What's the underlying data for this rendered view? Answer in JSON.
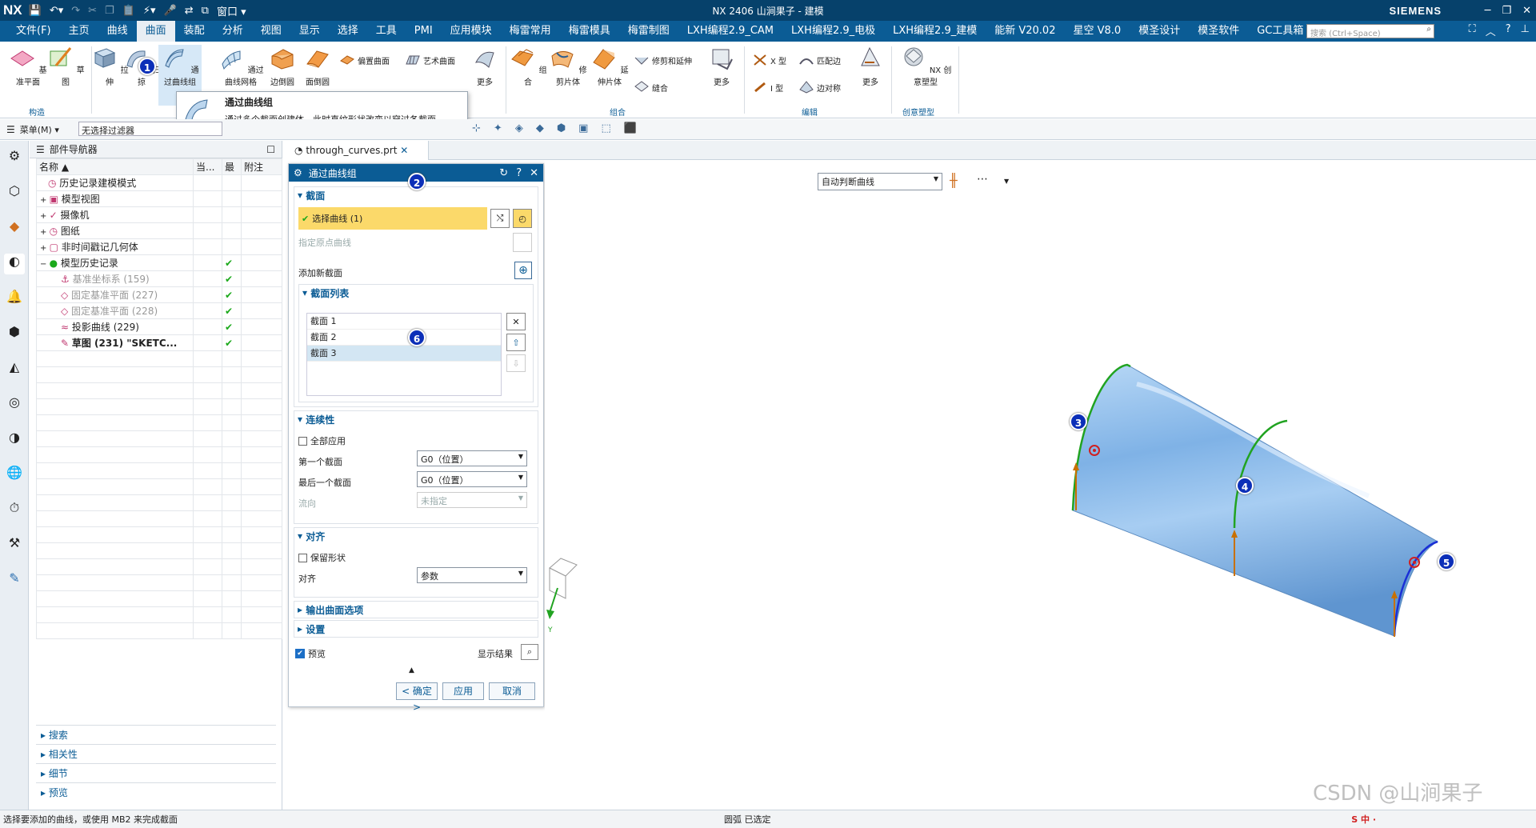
{
  "titlebar": {
    "app": "NX",
    "title": "NX 2406 山涧果子 - 建模",
    "brand": "SIEMENS",
    "window_menu": "窗口"
  },
  "menubar": {
    "file": "文件(F)",
    "items": [
      "主页",
      "曲线",
      "曲面",
      "装配",
      "分析",
      "视图",
      "显示",
      "选择",
      "工具",
      "PMI",
      "应用模块",
      "梅雷常用",
      "梅雷模具",
      "梅雷制图",
      "LXH编程2.9_CAM",
      "LXH编程2.9_电极",
      "LXH编程2.9_建模",
      "能新 V20.02",
      "星空 V8.0",
      "模圣设计",
      "模圣软件",
      "GC工具箱"
    ],
    "active_index": 2,
    "search_placeholder": "搜索 (Ctrl+Space)"
  },
  "ribbon": {
    "buttons": [
      {
        "label": "基准平面"
      },
      {
        "label": "草图"
      },
      {
        "label": "拉伸"
      },
      {
        "label": "扫掠"
      },
      {
        "label": "通过曲线组"
      },
      {
        "label": "通过曲线网格"
      },
      {
        "label": "边倒圆"
      },
      {
        "label": "面倒圆"
      },
      {
        "label": "更多"
      },
      {
        "label": "组合"
      },
      {
        "label": "修剪片体"
      },
      {
        "label": "延伸片体"
      },
      {
        "label": "更多"
      },
      {
        "label": "更多"
      },
      {
        "label": "NX 创意塑型"
      }
    ],
    "small": {
      "offset": "偏置曲面",
      "art": "艺术曲面",
      "trim_extend": "修剪和延伸",
      "sew": "缝合",
      "x_type": "X 型",
      "i_type": "I 型",
      "match_edge": "匹配边",
      "edge_sym": "边对称"
    },
    "groups": {
      "construct": "构造",
      "combine": "组合",
      "edit": "编辑",
      "creative": "创意塑型"
    }
  },
  "tooltip": {
    "title": "通过曲线组",
    "desc": "通过多个截面创建体，此时直纹形状改变以穿过各截面。"
  },
  "selbar": {
    "menu": "菜单(M)",
    "filter": "无选择过滤器"
  },
  "navigator": {
    "title": "部件导航器",
    "columns": [
      "名称",
      "当...",
      "最",
      "附注"
    ],
    "rows": [
      {
        "name": "历史记录建模模式",
        "style": "",
        "check": ""
      },
      {
        "name": "模型视图",
        "style": "",
        "check": ""
      },
      {
        "name": "摄像机",
        "style": "",
        "check": ""
      },
      {
        "name": "图纸",
        "style": "",
        "check": ""
      },
      {
        "name": "非时间戳记几何体",
        "style": "",
        "check": ""
      },
      {
        "name": "模型历史记录",
        "style": "",
        "check": "✔"
      },
      {
        "name": "基准坐标系 (159)",
        "style": "gray",
        "check": "✔"
      },
      {
        "name": "固定基准平面 (227)",
        "style": "gray",
        "check": "✔"
      },
      {
        "name": "固定基准平面 (228)",
        "style": "gray",
        "check": "✔"
      },
      {
        "name": "投影曲线 (229)",
        "style": "",
        "check": "✔"
      },
      {
        "name": "草图 (231) \"SKETC...",
        "style": "bold",
        "check": "✔"
      }
    ],
    "bottom": [
      "搜索",
      "相关性",
      "细节",
      "预览"
    ]
  },
  "tab": {
    "file": "through_curves.prt"
  },
  "dialog": {
    "title": "通过曲线组",
    "section_label": "截面",
    "select_curve": "选择曲线 (1)",
    "origin_curve": "指定原点曲线",
    "add_section": "添加新截面",
    "list_label": "截面列表",
    "list": [
      "截面 1",
      "截面 2",
      "截面 3"
    ],
    "continuity_label": "连续性",
    "apply_all": "全部应用",
    "first_section": "第一个截面",
    "first_value": "G0（位置）",
    "last_section": "最后一个截面",
    "last_value": "G0（位置）",
    "flow_dir": "流向",
    "flow_value": "未指定",
    "align_label": "对齐",
    "keep_shape": "保留形状",
    "align": "对齐",
    "align_value": "参数",
    "output_options": "输出曲面选项",
    "settings": "设置",
    "preview": "预览",
    "show_result": "显示结果",
    "ok": "< 确定 >",
    "apply": "应用",
    "cancel": "取消"
  },
  "viewport": {
    "curve_rule": "自动判断曲线"
  },
  "status": {
    "left": "选择要添加的曲线，或使用 MB2 来完成截面",
    "center": "圆弧 已选定",
    "watermark": "CSDN @山涧果子"
  },
  "badges": [
    "1",
    "2",
    "3",
    "4",
    "5",
    "6"
  ],
  "colors": {
    "title_bg": "#06416b",
    "menu_bg": "#0b5c95",
    "surface": "#7fb2e6",
    "badge": "#0c2fb8"
  }
}
